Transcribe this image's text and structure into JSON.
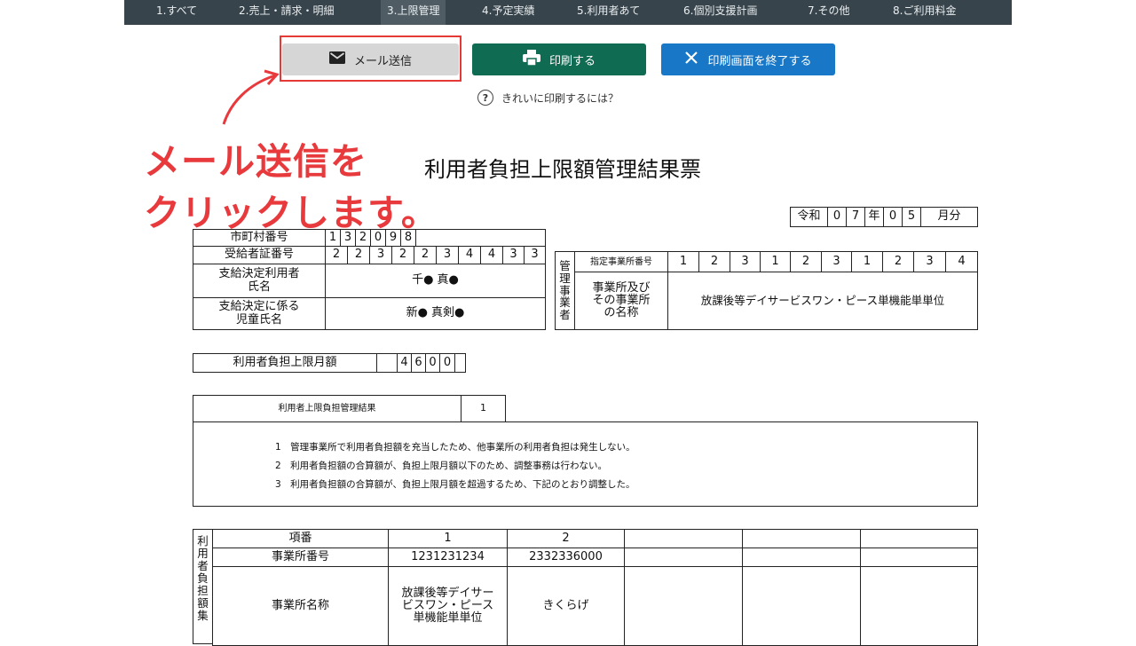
{
  "nav": {
    "tabs": [
      "1.すべて",
      "2.売上・請求・明細",
      "3.上限管理",
      "4.予定実績",
      "5.利用者あて",
      "6.個別支援計画",
      "7.その他",
      "8.ご利用料金"
    ],
    "active_index": 2
  },
  "toolbar": {
    "mail_label": "メール送信",
    "print_label": "印刷する",
    "close_label": "印刷画面を終了する",
    "help_text": "きれいに印刷するには？"
  },
  "annotation": {
    "line1": "メール送信を",
    "line2": "クリックします。",
    "color": "#e8393d"
  },
  "document": {
    "title": "利用者負担上限額管理結果票",
    "date": {
      "era": "令和",
      "year": [
        "0",
        "7"
      ],
      "year_label": "年",
      "month": [
        "0",
        "5"
      ],
      "month_label": "月分"
    },
    "city_no_label": "市町村番号",
    "city_no": [
      "1",
      "3",
      "2",
      "0",
      "9",
      "8"
    ],
    "cert_no_label": "受給者証番号",
    "cert_no": [
      "2",
      "2",
      "3",
      "2",
      "2",
      "3",
      "4",
      "4",
      "3",
      "3"
    ],
    "user_name_label_1": "支給決定利用者",
    "user_name_label_2": "氏名",
    "user_name": "千● 真●",
    "child_name_label_1": "支給決定に係る",
    "child_name_label_2": "児童氏名",
    "child_name": "新● 真剣●",
    "mgmt_vertical": [
      "管",
      "理",
      "事",
      "業",
      "者"
    ],
    "facility_no_label": "指定事業所番号",
    "facility_no": [
      "1",
      "2",
      "3",
      "1",
      "2",
      "3",
      "1",
      "2",
      "3",
      "4"
    ],
    "facility_name_label_1": "事業所及び",
    "facility_name_label_2": "その事業所",
    "facility_name_label_3": "の名称",
    "facility_name": "放課後等デイサービスワン・ピース単機能単単位",
    "limit_label": "利用者負担上限月額",
    "limit_digits": [
      "4",
      "6",
      "0",
      "0"
    ],
    "result_label": "利用者上限負担管理結果",
    "result_value": "1",
    "notes": [
      "1　管理事業所で利用者負担額を充当したため、他事業所の利用者負担は発生しない。",
      "2　利用者負担額の合算額が、負担上限月額以下のため、調整事務は行わない。",
      "3　利用者負担額の合算額が、負担上限月額を超過するため、下記のとおり調整した。"
    ],
    "bottom_vertical": [
      "利",
      "用",
      "者",
      "負",
      "担",
      "額",
      "集"
    ],
    "bottom": {
      "item_label": "項番",
      "facility_no_label": "事業所番号",
      "facility_name_label": "事業所名称",
      "cols": [
        {
          "item": "1",
          "no": "1231231234",
          "name_1": "放課後等デイサー",
          "name_2": "ビスワン・ピース",
          "name_3": "単機能単単位"
        },
        {
          "item": "2",
          "no": "2332336000",
          "name_1": "きくらげ",
          "name_2": "",
          "name_3": ""
        }
      ]
    }
  }
}
